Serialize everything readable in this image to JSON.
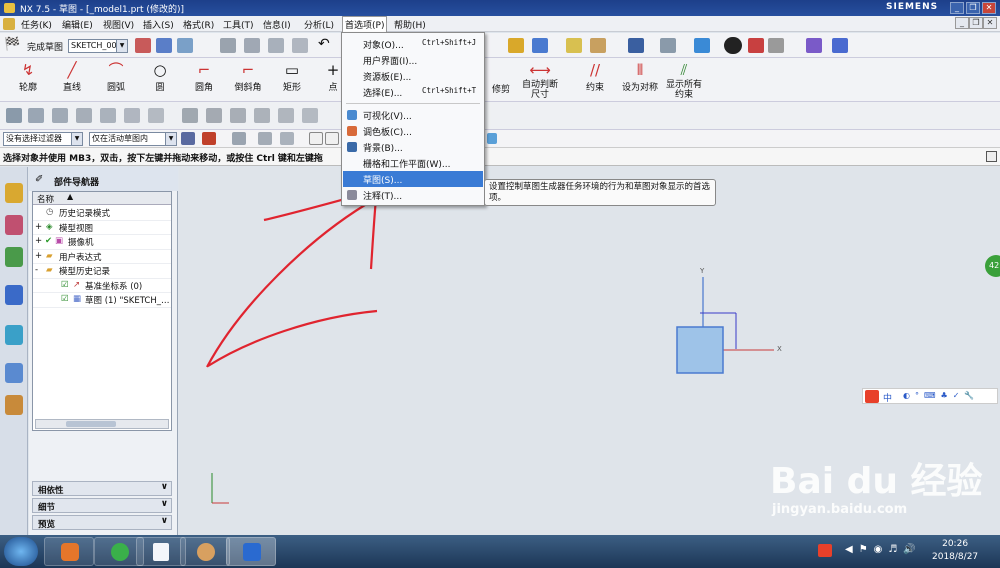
{
  "window": {
    "title": "NX 7.5 - 草图 - [_model1.prt (修改的)]",
    "brand": "SIEMENS",
    "controls": [
      "_",
      "❐",
      "✕"
    ],
    "doc_controls": [
      "_",
      "❐",
      "✕"
    ]
  },
  "menubar": {
    "items": [
      "任务(K)",
      "编辑(E)",
      "视图(V)",
      "插入(S)",
      "格式(R)",
      "工具(T)",
      "信息(I)",
      "分析(L)",
      "首选项(P)",
      "帮助(H)"
    ],
    "active": "首选项(P)"
  },
  "toolbar1": {
    "finish_sketch": "完成草图",
    "sketch_select": "SKETCH_000"
  },
  "toolbar2": {
    "tools": [
      "轮廓",
      "直线",
      "圆弧",
      "圆",
      "圆角",
      "倒斜角",
      "矩形",
      "点"
    ],
    "right_tools": [
      "修剪",
      "自动判断尺寸",
      "约束",
      "设为对称",
      "显示所有约束"
    ]
  },
  "filterbar": {
    "filter": "没有选择过滤器",
    "scope": "仅在活动草图内"
  },
  "cueline": {
    "text": "选择对象并使用 MB3，双击，按下左键并拖动来移动，或按住 Ctrl 键和左键拖"
  },
  "navigator": {
    "title": "部件导航器",
    "column": "名称",
    "rows": [
      {
        "label": "历史记录模式",
        "expand": ""
      },
      {
        "label": "模型视图",
        "expand": "+"
      },
      {
        "label": "摄像机",
        "expand": "+"
      },
      {
        "label": "用户表达式",
        "expand": "+"
      },
      {
        "label": "模型历史记录",
        "expand": "-"
      },
      {
        "label": "基准坐标系 (0)",
        "expand": ""
      },
      {
        "label": "草图 (1) \"SKETCH_…",
        "expand": ""
      }
    ],
    "accordions": [
      "相依性",
      "细节",
      "预览"
    ]
  },
  "dropdown": {
    "items": [
      {
        "label": "对象(O)...",
        "shortcut": "Ctrl+Shift+J"
      },
      {
        "label": "用户界面(I)...",
        "shortcut": ""
      },
      {
        "label": "资源板(E)...",
        "shortcut": ""
      },
      {
        "label": "选择(E)...",
        "shortcut": "Ctrl+Shift+T"
      },
      {
        "label": "可视化(V)...",
        "shortcut": ""
      },
      {
        "label": "调色板(C)...",
        "shortcut": ""
      },
      {
        "label": "背景(B)...",
        "shortcut": ""
      },
      {
        "label": "栅格和工作平面(W)...",
        "shortcut": ""
      },
      {
        "label": "草图(S)...",
        "shortcut": ""
      },
      {
        "label": "注释(T)...",
        "shortcut": ""
      }
    ],
    "highlighted": "草图(S)..."
  },
  "tooltip": {
    "text": "设置控制草图生成器任务环境的行为和草图对象显示的首选项。"
  },
  "canvas": {
    "axis_x": "X",
    "axis_y": "Y",
    "badge": "42"
  },
  "ime": {
    "label": "中"
  },
  "watermark": {
    "brand": "Bai du 经验",
    "url": "jingyan.baidu.com"
  },
  "taskbar": {
    "time": "20:26",
    "date": "2018/8/27"
  },
  "colors": {
    "titlebar": "#274f9f",
    "highlight": "#3a7bd5",
    "annotation": "#e0242f"
  }
}
